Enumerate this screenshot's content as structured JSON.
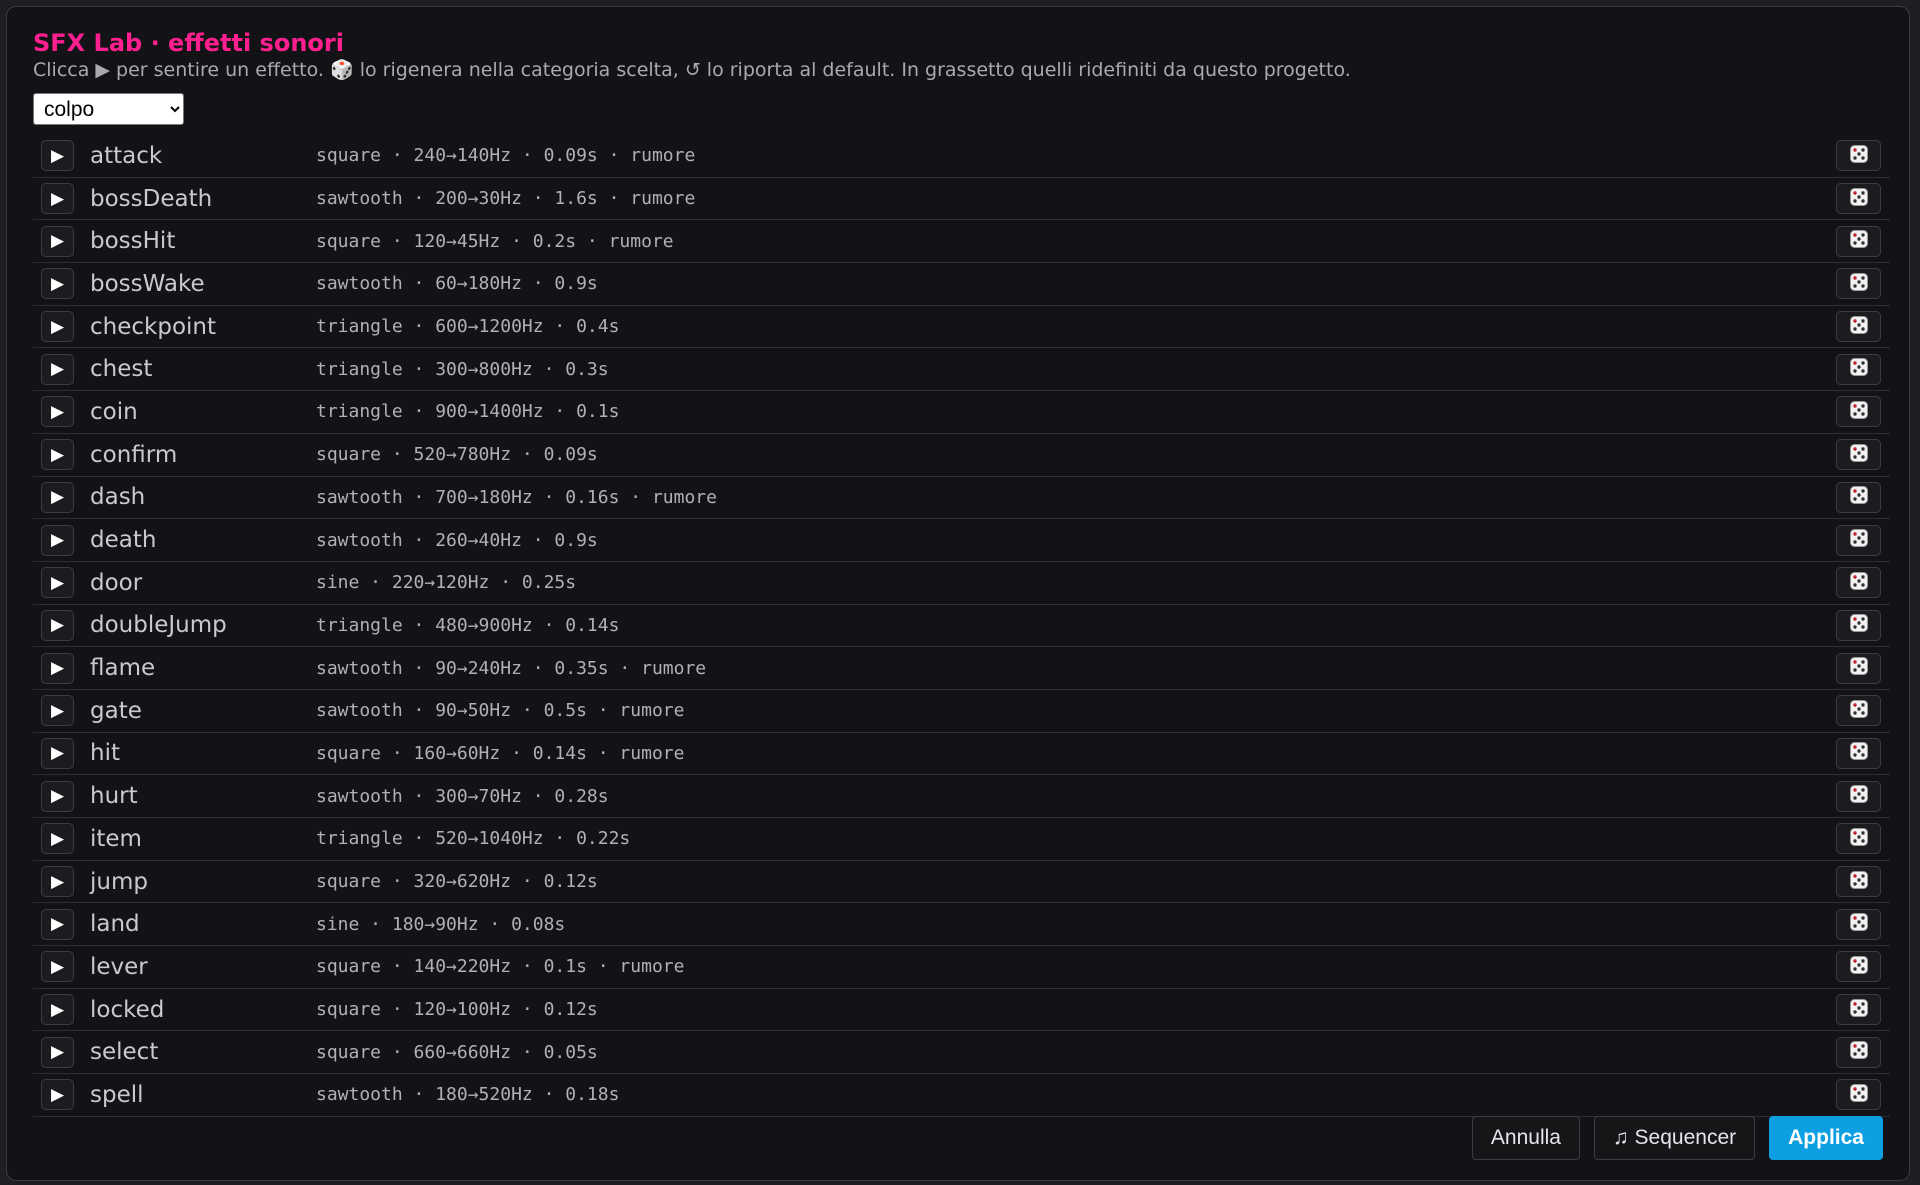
{
  "header": {
    "title": "SFX Lab · effetti sonori",
    "subtitle": "Clicca ▶ per sentire un effetto. 🎲 lo rigenera nella categoria scelta, ↺ lo riporta al default. In grassetto quelli ridefiniti da questo progetto."
  },
  "category_select": {
    "value": "colpo"
  },
  "sounds": [
    {
      "name": "attack",
      "desc": "square · 240→140Hz · 0.09s · rumore"
    },
    {
      "name": "bossDeath",
      "desc": "sawtooth · 200→30Hz · 1.6s · rumore"
    },
    {
      "name": "bossHit",
      "desc": "square · 120→45Hz · 0.2s · rumore"
    },
    {
      "name": "bossWake",
      "desc": "sawtooth · 60→180Hz · 0.9s"
    },
    {
      "name": "checkpoint",
      "desc": "triangle · 600→1200Hz · 0.4s"
    },
    {
      "name": "chest",
      "desc": "triangle · 300→800Hz · 0.3s"
    },
    {
      "name": "coin",
      "desc": "triangle · 900→1400Hz · 0.1s"
    },
    {
      "name": "confirm",
      "desc": "square · 520→780Hz · 0.09s"
    },
    {
      "name": "dash",
      "desc": "sawtooth · 700→180Hz · 0.16s · rumore"
    },
    {
      "name": "death",
      "desc": "sawtooth · 260→40Hz · 0.9s"
    },
    {
      "name": "door",
      "desc": "sine · 220→120Hz · 0.25s"
    },
    {
      "name": "doubleJump",
      "desc": "triangle · 480→900Hz · 0.14s"
    },
    {
      "name": "flame",
      "desc": "sawtooth · 90→240Hz · 0.35s · rumore"
    },
    {
      "name": "gate",
      "desc": "sawtooth · 90→50Hz · 0.5s · rumore"
    },
    {
      "name": "hit",
      "desc": "square · 160→60Hz · 0.14s · rumore"
    },
    {
      "name": "hurt",
      "desc": "sawtooth · 300→70Hz · 0.28s"
    },
    {
      "name": "item",
      "desc": "triangle · 520→1040Hz · 0.22s"
    },
    {
      "name": "jump",
      "desc": "square · 320→620Hz · 0.12s"
    },
    {
      "name": "land",
      "desc": "sine · 180→90Hz · 0.08s"
    },
    {
      "name": "lever",
      "desc": "square · 140→220Hz · 0.1s · rumore"
    },
    {
      "name": "locked",
      "desc": "square · 120→100Hz · 0.12s"
    },
    {
      "name": "select",
      "desc": "square · 660→660Hz · 0.05s"
    },
    {
      "name": "spell",
      "desc": "sawtooth · 180→520Hz · 0.18s"
    }
  ],
  "icons": {
    "play": "play-icon",
    "dice": "dice-icon"
  },
  "footer": {
    "cancel_label": "Annulla",
    "sequencer_label": "♫ Sequencer",
    "apply_label": "Applica"
  },
  "colors": {
    "title": "#ff1f8e",
    "accent": "#0e9fe3",
    "background": "#131317"
  }
}
